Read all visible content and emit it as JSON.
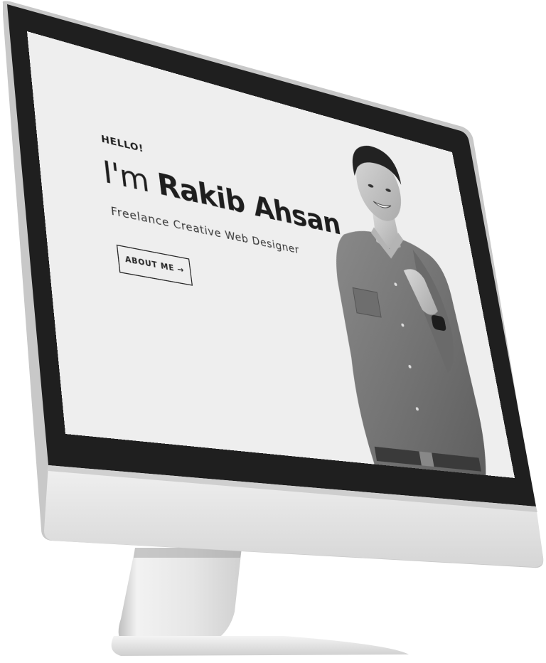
{
  "hero": {
    "greeting": "HELLO!",
    "intro_prefix": "I'm",
    "name": "Rakib Ahsan",
    "tagline": "Freelance Creative Web Designer",
    "about_button": "ABOUT ME →"
  },
  "colors": {
    "screen_bg": "#eeeeee",
    "bezel": "#1f1f1f",
    "text": "#1e1e1e",
    "chassis": "#e2e2e2"
  }
}
